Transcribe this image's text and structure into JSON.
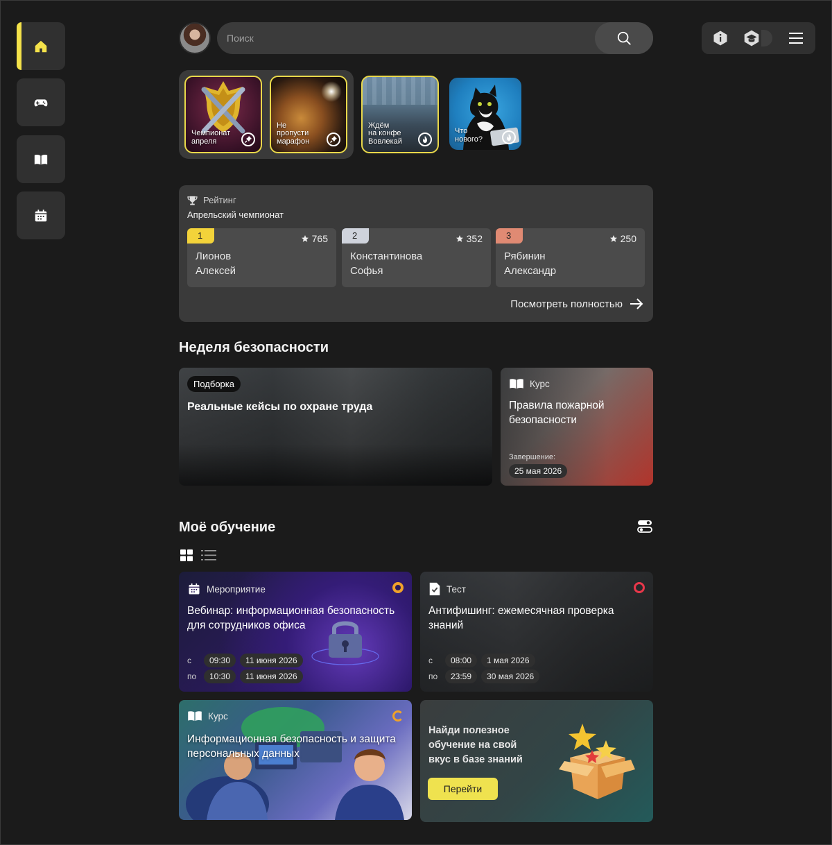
{
  "search": {
    "placeholder": "Поиск"
  },
  "sidebar": {
    "items": [
      {
        "icon": "home-icon"
      },
      {
        "icon": "gamepad-icon"
      },
      {
        "icon": "book-icon"
      },
      {
        "icon": "calendar-icon"
      }
    ]
  },
  "top_tools": {
    "icons": [
      "info-icon",
      "graduation-cap-icon",
      "menu-icon"
    ]
  },
  "stories": [
    {
      "label": "Чемпионат\nапреля",
      "badge": "pin-icon"
    },
    {
      "label": "Не\nпропусти\nмарафон",
      "badge": "pin-icon"
    },
    {
      "label": "Ждём\nна конфе\nВовлекай",
      "badge": "fire-icon"
    },
    {
      "label": "Что\nнового?",
      "badge": "fire-icon"
    }
  ],
  "rating": {
    "title": "Рейтинг",
    "subtitle": "Апрельский чемпионат",
    "places": [
      {
        "num": "1",
        "score": "765",
        "first": "Лионов",
        "last": "Алексей",
        "color": "#f3d33a"
      },
      {
        "num": "2",
        "score": "352",
        "first": "Константинова",
        "last": "Софья",
        "color": "#cfd3dc"
      },
      {
        "num": "3",
        "score": "250",
        "first": "Рябинин",
        "last": "Александр",
        "color": "#e08a73"
      }
    ],
    "more": "Посмотреть полностью"
  },
  "safety_week": {
    "title": "Неделя безопасности",
    "collection": {
      "chip": "Подборка",
      "title": "Реальные кейсы по охране труда"
    },
    "course": {
      "type": "Курс",
      "title": "Правила пожарной\nбезопасности",
      "end_label": "Завершение:",
      "end_date": "25 мая 2026"
    }
  },
  "my_learning": {
    "title": "Моё обучение",
    "cards": [
      {
        "type": "Мероприятие",
        "title": "Вебинар: информационная безопасность\nдля сотрудников офиса",
        "from_label": "с",
        "from_time": "09:30",
        "from_date": "11 июня 2026",
        "to_label": "по",
        "to_time": "10:30",
        "to_date": "11 июня 2026",
        "status_color": "#f0a22a"
      },
      {
        "type": "Тест",
        "title": "Антифишинг: ежемесячная проверка\nзнаний",
        "from_label": "с",
        "from_time": "08:00",
        "from_date": "1 мая 2026",
        "to_label": "по",
        "to_time": "23:59",
        "to_date": "30 мая 2026",
        "status_color": "#e8374a"
      },
      {
        "type": "Курс",
        "title": "Информационная безопасность и защита\nперсональных данных",
        "status_color": "#f0a22a"
      }
    ],
    "promo": {
      "text": "Найди полезное\nобучение на свой\nвкус в базе знаний",
      "button": "Перейти"
    }
  },
  "colors": {
    "accent": "#f4e24a",
    "bg": "#1b1b1b",
    "panel": "#3a3a3a"
  }
}
